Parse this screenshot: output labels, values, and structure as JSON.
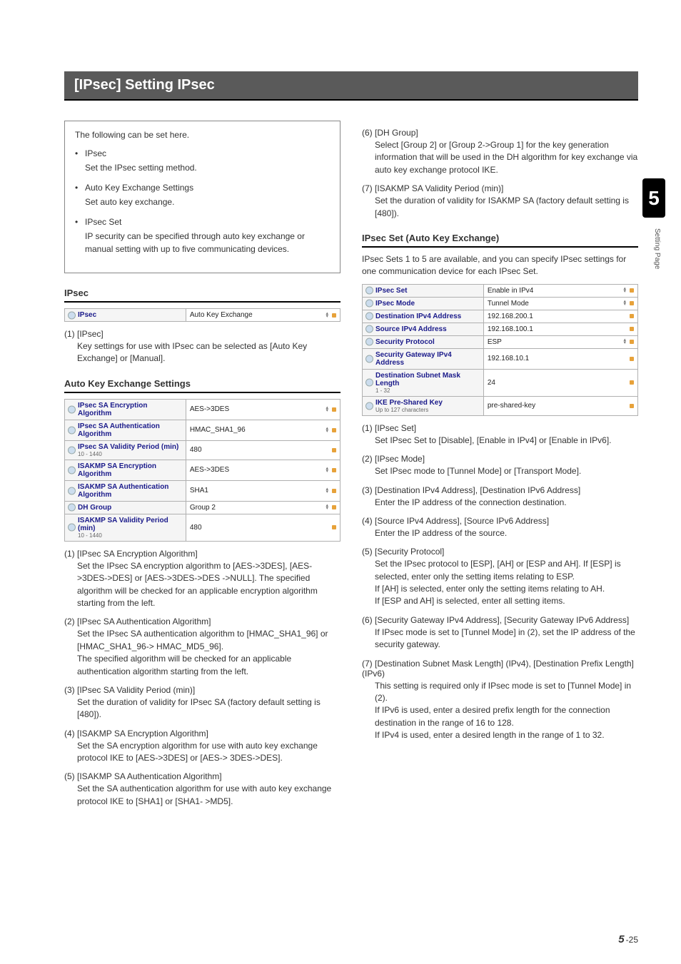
{
  "title": "[IPsec] Setting IPsec",
  "side_tab": "5",
  "side_label": "Setting Page",
  "footer": {
    "chapter": "5",
    "sep": "-",
    "page": "25"
  },
  "intro": {
    "lead": "The following can be set here.",
    "items": [
      {
        "title": "IPsec",
        "desc": "Set the IPsec setting method."
      },
      {
        "title": "Auto Key Exchange Settings",
        "desc": "Set auto key exchange."
      },
      {
        "title": "IPsec Set",
        "desc": "IP security can be specified through auto key exchange or manual setting with up to five communicating devices."
      }
    ]
  },
  "left": {
    "ipsec_head": "IPsec",
    "ipsec_table": [
      {
        "label": "IPsec",
        "value": "Auto Key Exchange",
        "dropdown": true
      }
    ],
    "ipsec_param": {
      "num": "(1)",
      "name": "[IPsec]",
      "body": "Key settings for use with IPsec can be selected as [Auto Key Exchange] or [Manual]."
    },
    "ake_head": "Auto Key Exchange Settings",
    "ake_table": [
      {
        "label": "IPsec SA Encryption Algorithm",
        "value": "AES->3DES",
        "dropdown": true
      },
      {
        "label": "IPsec SA Authentication Algorithm",
        "value": "HMAC_SHA1_96",
        "dropdown": true
      },
      {
        "label": "IPsec SA Validity Period (min)",
        "hint": "10 - 1440",
        "value": "480"
      },
      {
        "label": "ISAKMP SA Encryption Algorithm",
        "value": "AES->3DES",
        "dropdown": true
      },
      {
        "label": "ISAKMP SA Authentication Algorithm",
        "value": "SHA1",
        "dropdown": true
      },
      {
        "label": "DH Group",
        "value": "Group 2",
        "dropdown": true
      },
      {
        "label": "ISAKMP SA Validity Period (min)",
        "hint": "10 - 1440",
        "value": "480"
      }
    ],
    "ake_params": [
      {
        "num": "(1)",
        "name": "[IPsec SA Encryption Algorithm]",
        "body": "Set the IPsec SA encryption algorithm to [AES->3DES], [AES->3DES->DES] or [AES->3DES->DES ->NULL]. The specified algorithm will be checked for an applicable encryption algorithm starting from the left."
      },
      {
        "num": "(2)",
        "name": "[IPsec SA Authentication Algorithm]",
        "body": "Set the IPsec SA authentication algorithm to [HMAC_SHA1_96] or [HMAC_SHA1_96-> HMAC_MD5_96].\nThe specified algorithm will be checked for an applicable authentication algorithm starting from the left."
      },
      {
        "num": "(3)",
        "name": "[IPsec SA Validity Period (min)]",
        "body": "Set the duration of validity for IPsec SA (factory default setting is [480])."
      },
      {
        "num": "(4)",
        "name": "[ISAKMP SA Encryption Algorithm]",
        "body": "Set the SA encryption algorithm for use with auto key exchange protocol IKE to [AES->3DES] or [AES-> 3DES->DES]."
      },
      {
        "num": "(5)",
        "name": "[ISAKMP SA Authentication Algorithm]",
        "body": "Set the SA authentication algorithm for use with auto key exchange protocol IKE to [SHA1] or [SHA1- >MD5]."
      }
    ]
  },
  "right": {
    "top_params": [
      {
        "num": "(6)",
        "name": "[DH Group]",
        "body": "Select [Group 2] or [Group 2->Group 1] for the key generation information that will be used in the DH algorithm for key exchange via auto key exchange protocol IKE."
      },
      {
        "num": "(7)",
        "name": "[ISAKMP SA Validity Period (min)]",
        "body": "Set the duration of validity for ISAKMP SA (factory default setting is [480])."
      }
    ],
    "set_head": "IPsec Set (Auto Key Exchange)",
    "set_intro": "IPsec Sets 1 to 5 are available, and you can specify IPsec settings for one communication device for each IPsec Set.",
    "set_table": [
      {
        "label": "IPsec Set",
        "value": "Enable in IPv4",
        "dropdown": true
      },
      {
        "label": "IPsec Mode",
        "value": "Tunnel Mode",
        "dropdown": true
      },
      {
        "label": "Destination IPv4 Address",
        "value": "192.168.200.1"
      },
      {
        "label": "Source IPv4 Address",
        "value": "192.168.100.1"
      },
      {
        "label": "Security Protocol",
        "value": "ESP",
        "dropdown": true
      },
      {
        "label": "Security Gateway IPv4 Address",
        "value": "192.168.10.1"
      },
      {
        "label": "Destination Subnet Mask Length",
        "hint": "1 - 32",
        "value": "24"
      },
      {
        "label": "IKE Pre-Shared Key",
        "hint": "Up to 127 characters",
        "value": "pre-shared-key"
      }
    ],
    "set_params": [
      {
        "num": "(1)",
        "name": "[IPsec Set]",
        "body": "Set IPsec Set to [Disable], [Enable in IPv4] or [Enable in IPv6]."
      },
      {
        "num": "(2)",
        "name": "[IPsec Mode]",
        "body": "Set IPsec mode to [Tunnel Mode] or [Transport Mode]."
      },
      {
        "num": "(3)",
        "name": "[Destination IPv4 Address], [Destination IPv6 Address]",
        "body": "Enter the IP address of the connection destination."
      },
      {
        "num": "(4)",
        "name": "[Source IPv4 Address], [Source IPv6 Address]",
        "body": "Enter the IP address of the source."
      },
      {
        "num": "(5)",
        "name": "[Security Protocol]",
        "body": "Set the IPsec protocol to [ESP], [AH] or [ESP and AH]. If [ESP] is selected, enter only the setting items relating to ESP.\nIf [AH] is selected, enter only the setting items relating to AH.\nIf [ESP and AH] is selected, enter all setting items."
      },
      {
        "num": "(6)",
        "name": "[Security Gateway IPv4 Address], [Security Gateway IPv6 Address]",
        "body": "If IPsec mode is set to [Tunnel Mode] in (2), set the IP address of the security gateway."
      },
      {
        "num": "(7)",
        "name": "[Destination Subnet Mask Length] (IPv4), [Destination Prefix Length] (IPv6)",
        "body": "This setting is required only if IPsec mode is set to [Tunnel Mode] in (2).\nIf IPv6 is used, enter a desired prefix length for the connection destination in the range of 16 to 128.\nIf IPv4 is used, enter a desired length in the range of 1 to 32."
      }
    ]
  }
}
